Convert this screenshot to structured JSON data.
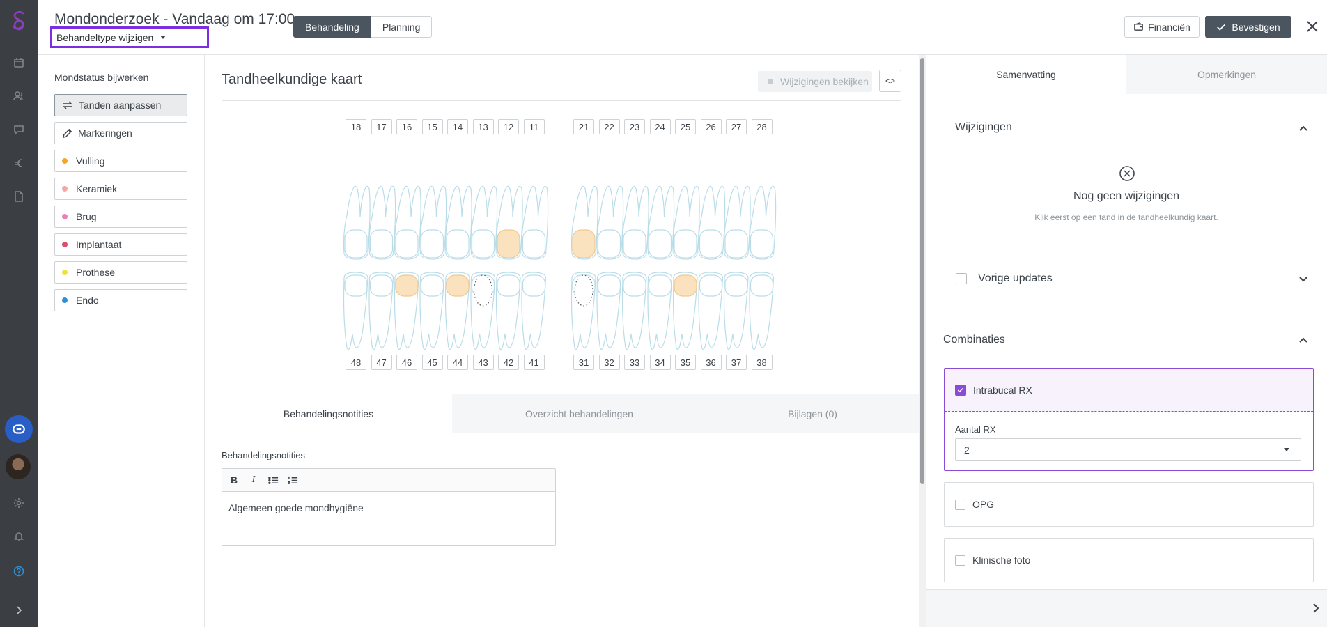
{
  "header": {
    "title": "Mondonderzoek - Vandaag om 17:00",
    "type_button": "Behandeltype wijzigen",
    "seg_active": "Behandeling",
    "seg_inactive": "Planning",
    "financien": "Financiën",
    "bevestigen": "Bevestigen"
  },
  "left": {
    "heading": "Mondstatus bijwerken",
    "items": [
      {
        "label": "Tanden aanpassen",
        "icon": "swap-icon"
      },
      {
        "label": "Markeringen",
        "icon": "pencil-icon"
      },
      {
        "label": "Vulling",
        "color": "#f5a623"
      },
      {
        "label": "Keramiek",
        "color": "#f4a7a7"
      },
      {
        "label": "Brug",
        "color": "#ee7fb5"
      },
      {
        "label": "Implantaat",
        "color": "#d94f6e"
      },
      {
        "label": "Prothese",
        "color": "#f2e03a"
      },
      {
        "label": "Endo",
        "color": "#2f8fd6"
      }
    ]
  },
  "chart": {
    "title": "Tandheelkundige kaart",
    "wijzigingen_btn": "Wijzigingen bekijken",
    "code_btn": "<>",
    "upper_left": [
      "18",
      "17",
      "16",
      "15",
      "14",
      "13",
      "12",
      "11"
    ],
    "upper_right": [
      "21",
      "22",
      "23",
      "24",
      "25",
      "26",
      "27",
      "28"
    ],
    "lower_left": [
      "48",
      "47",
      "46",
      "45",
      "44",
      "43",
      "42",
      "41"
    ],
    "lower_right": [
      "31",
      "32",
      "33",
      "34",
      "35",
      "36",
      "37",
      "38"
    ]
  },
  "tabs": {
    "t1": "Behandelingsnotities",
    "t2": "Overzicht behandelingen",
    "t3": "Bijlagen (0)"
  },
  "notes": {
    "label": "Behandelingsnotities",
    "text": "Algemeen goede mondhygiëne"
  },
  "right": {
    "tab1": "Samenvatting",
    "tab2": "Opmerkingen",
    "wijzigingen": "Wijzigingen",
    "empty_title": "Nog geen wijzigingen",
    "empty_sub": "Klik eerst op een tand in de tandheelkundig kaart.",
    "vorige": "Vorige updates",
    "combinaties": "Combinaties",
    "intrabucal": "Intrabucal RX",
    "aantal_label": "Aantal RX",
    "aantal_value": "2",
    "opg": "OPG",
    "klinische": "Klinische foto"
  },
  "colors": {
    "accent": "#7b2fe0",
    "filled_tooth": "#fbe2bf",
    "dark_button": "#4a5560"
  }
}
